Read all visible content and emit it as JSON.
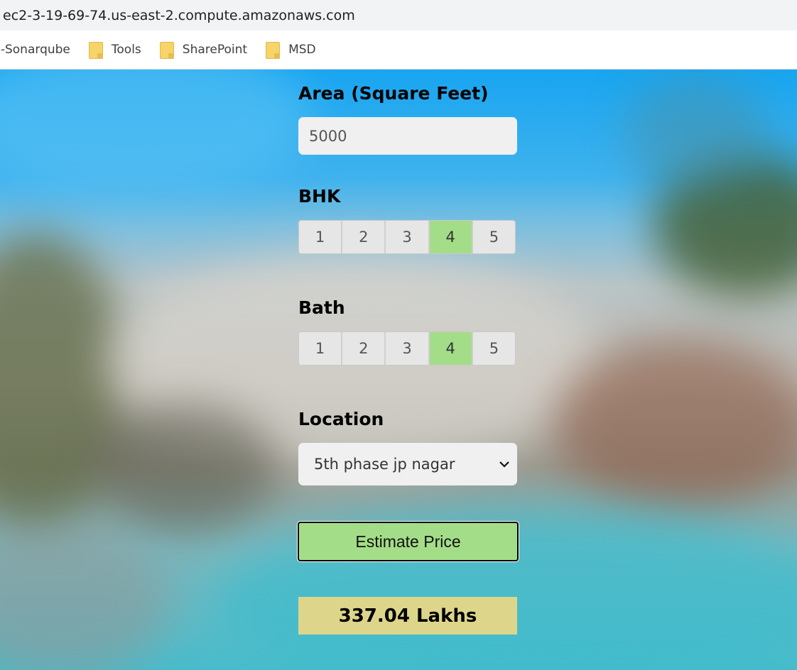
{
  "browser": {
    "url": "ec2-3-19-69-74.us-east-2.compute.amazonaws.com",
    "bookmarks": [
      {
        "label": "s-Sonarqube",
        "icon": "none"
      },
      {
        "label": "Tools",
        "icon": "folder-icon"
      },
      {
        "label": "SharePoint",
        "icon": "folder-icon"
      },
      {
        "label": "MSD",
        "icon": "folder-icon"
      }
    ]
  },
  "form": {
    "area_label": "Area (Square Feet)",
    "area_value": "5000",
    "bhk_label": "BHK",
    "bhk_options": [
      "1",
      "2",
      "3",
      "4",
      "5"
    ],
    "bhk_selected": "4",
    "bath_label": "Bath",
    "bath_options": [
      "1",
      "2",
      "3",
      "4",
      "5"
    ],
    "bath_selected": "4",
    "location_label": "Location",
    "location_value": "5th phase jp nagar",
    "estimate_button": "Estimate Price",
    "result": "337.04 Lakhs"
  },
  "colors": {
    "selected_option": "#a4dd88",
    "button_bg": "#a4dd88",
    "result_bg": "#ddd68a",
    "input_bg": "#f0f0f0"
  }
}
